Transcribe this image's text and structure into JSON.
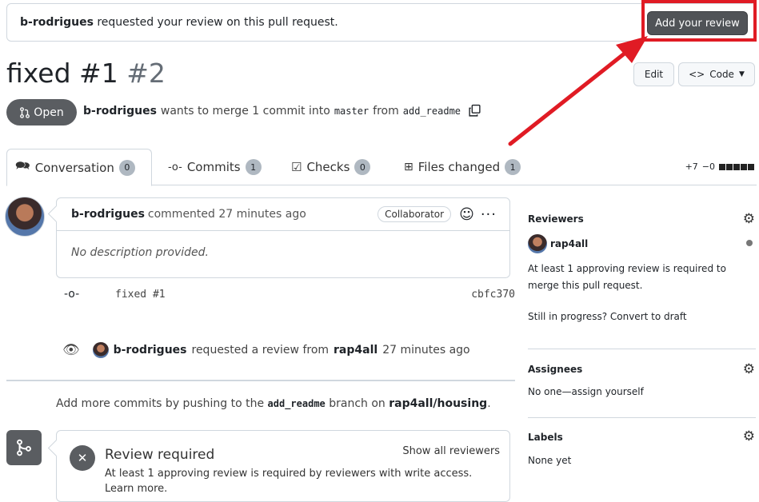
{
  "banner": {
    "user": "b-rodrigues",
    "message": "requested your review on this pull request.",
    "button_label": "Add your review"
  },
  "pr": {
    "title": "fixed #1",
    "number": "#2",
    "edit_label": "Edit",
    "code_label": "Code",
    "state": "Open",
    "author": "b-rodrigues",
    "merge_text": "wants to merge 1 commit into",
    "base_branch": "master",
    "from_text": "from",
    "head_branch": "add_readme"
  },
  "tabs": [
    {
      "label": "Conversation",
      "count": "0"
    },
    {
      "label": "Commits",
      "count": "1"
    },
    {
      "label": "Checks",
      "count": "0"
    },
    {
      "label": "Files changed",
      "count": "1"
    }
  ],
  "diffstat": {
    "additions": "+7",
    "deletions": "−0"
  },
  "comment": {
    "author": "b-rodrigues",
    "action": "commented 27 minutes ago",
    "badge": "Collaborator",
    "body": "No description provided."
  },
  "commit": {
    "message": "fixed #1",
    "sha": "cbfc370"
  },
  "review_request": {
    "user": "b-rodrigues",
    "text": "requested a review from",
    "reviewer": "rap4all",
    "time": "27 minutes ago"
  },
  "push_hint": {
    "prefix": "Add more commits by pushing to the",
    "branch": "add_readme",
    "middle": "branch on",
    "repo": "rap4all/housing",
    "suffix": "."
  },
  "review_required": {
    "title": "Review required",
    "show_all": "Show all reviewers",
    "description": "At least 1 approving review is required by reviewers with write access.",
    "learn_more": "Learn more."
  },
  "sidebar": {
    "reviewers_heading": "Reviewers",
    "reviewer_name": "rap4all",
    "requirement": "At least 1 approving review is required to merge this pull request.",
    "in_progress": "Still in progress? Convert to draft",
    "assignees_heading": "Assignees",
    "assignees_value": "No one—assign yourself",
    "labels_heading": "Labels",
    "labels_value": "None yet"
  },
  "colors": {
    "highlight": "#e01b24",
    "state_badge": "#5a5d61"
  }
}
